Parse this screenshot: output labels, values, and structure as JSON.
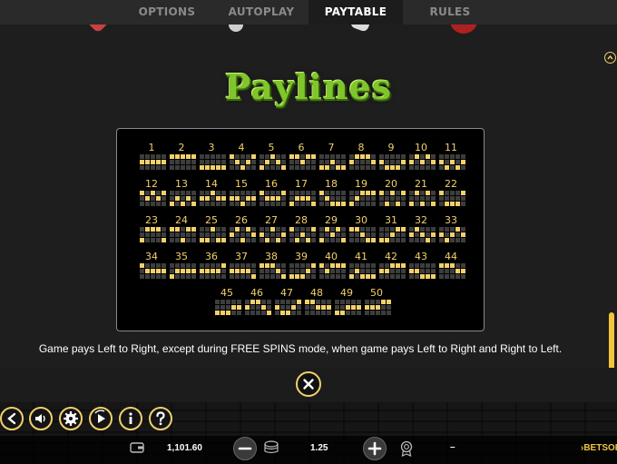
{
  "tabs": [
    {
      "label": "OPTIONS",
      "active": false
    },
    {
      "label": "AUTOPLAY",
      "active": false
    },
    {
      "label": "PAYTABLE",
      "active": true
    },
    {
      "label": "RULES",
      "active": false
    }
  ],
  "paytable": {
    "title": "Paylines",
    "description": "Game pays Left to Right, except during FREE SPINS mode, when game pays Left to Right and Right to Left."
  },
  "paylines": [
    {
      "n": "1",
      "rows": [
        1,
        1,
        1,
        1,
        1
      ]
    },
    {
      "n": "2",
      "rows": [
        0,
        0,
        0,
        0,
        0
      ]
    },
    {
      "n": "3",
      "rows": [
        2,
        2,
        2,
        2,
        2
      ]
    },
    {
      "n": "4",
      "rows": [
        0,
        1,
        2,
        1,
        0
      ]
    },
    {
      "n": "5",
      "rows": [
        2,
        1,
        0,
        1,
        2
      ]
    },
    {
      "n": "6",
      "rows": [
        0,
        0,
        1,
        0,
        0
      ]
    },
    {
      "n": "7",
      "rows": [
        2,
        2,
        1,
        2,
        2
      ]
    },
    {
      "n": "8",
      "rows": [
        1,
        0,
        0,
        0,
        1
      ]
    },
    {
      "n": "9",
      "rows": [
        1,
        2,
        2,
        2,
        1
      ]
    },
    {
      "n": "10",
      "rows": [
        1,
        0,
        1,
        0,
        1
      ]
    },
    {
      "n": "11",
      "rows": [
        1,
        2,
        1,
        2,
        1
      ]
    },
    {
      "n": "12",
      "rows": [
        0,
        1,
        0,
        1,
        0
      ]
    },
    {
      "n": "13",
      "rows": [
        2,
        1,
        2,
        1,
        2
      ]
    },
    {
      "n": "14",
      "rows": [
        1,
        1,
        0,
        1,
        1
      ]
    },
    {
      "n": "15",
      "rows": [
        1,
        1,
        2,
        1,
        1
      ]
    },
    {
      "n": "16",
      "rows": [
        0,
        1,
        1,
        1,
        0
      ]
    },
    {
      "n": "17",
      "rows": [
        2,
        1,
        1,
        1,
        2
      ]
    },
    {
      "n": "18",
      "rows": [
        0,
        1,
        2,
        2,
        2
      ]
    },
    {
      "n": "19",
      "rows": [
        2,
        1,
        0,
        0,
        0
      ]
    },
    {
      "n": "20",
      "rows": [
        0,
        2,
        0,
        2,
        0
      ]
    },
    {
      "n": "21",
      "rows": [
        2,
        0,
        2,
        0,
        2
      ]
    },
    {
      "n": "22",
      "rows": [
        0,
        2,
        2,
        2,
        0
      ]
    },
    {
      "n": "23",
      "rows": [
        2,
        0,
        0,
        0,
        2
      ]
    },
    {
      "n": "24",
      "rows": [
        0,
        0,
        2,
        0,
        0
      ]
    },
    {
      "n": "25",
      "rows": [
        2,
        2,
        0,
        2,
        2
      ]
    },
    {
      "n": "26",
      "rows": [
        1,
        0,
        2,
        0,
        1
      ]
    },
    {
      "n": "27",
      "rows": [
        1,
        2,
        0,
        2,
        1
      ]
    },
    {
      "n": "28",
      "rows": [
        0,
        2,
        1,
        2,
        0
      ]
    },
    {
      "n": "29",
      "rows": [
        2,
        0,
        1,
        0,
        2
      ]
    },
    {
      "n": "30",
      "rows": [
        0,
        0,
        1,
        2,
        2
      ]
    },
    {
      "n": "31",
      "rows": [
        2,
        2,
        1,
        0,
        0
      ]
    },
    {
      "n": "32",
      "rows": [
        1,
        0,
        1,
        2,
        1
      ]
    },
    {
      "n": "33",
      "rows": [
        1,
        2,
        1,
        0,
        1
      ]
    },
    {
      "n": "34",
      "rows": [
        0,
        1,
        1,
        1,
        1
      ]
    },
    {
      "n": "35",
      "rows": [
        2,
        1,
        1,
        1,
        1
      ]
    },
    {
      "n": "36",
      "rows": [
        1,
        1,
        1,
        1,
        0
      ]
    },
    {
      "n": "37",
      "rows": [
        1,
        1,
        1,
        1,
        2
      ]
    },
    {
      "n": "38",
      "rows": [
        0,
        0,
        0,
        1,
        2
      ]
    },
    {
      "n": "39",
      "rows": [
        2,
        2,
        2,
        1,
        0
      ]
    },
    {
      "n": "40",
      "rows": [
        0,
        1,
        0,
        0,
        0
      ]
    },
    {
      "n": "41",
      "rows": [
        2,
        1,
        2,
        2,
        2
      ]
    },
    {
      "n": "42",
      "rows": [
        1,
        1,
        0,
        0,
        0
      ]
    },
    {
      "n": "43",
      "rows": [
        1,
        1,
        2,
        2,
        2
      ]
    },
    {
      "n": "44",
      "rows": [
        0,
        0,
        0,
        1,
        1
      ]
    },
    {
      "n": "45",
      "rows": [
        2,
        2,
        2,
        1,
        1
      ]
    },
    {
      "n": "46",
      "rows": [
        1,
        0,
        0,
        1,
        2
      ]
    },
    {
      "n": "47",
      "rows": [
        1,
        2,
        2,
        1,
        0
      ]
    },
    {
      "n": "48",
      "rows": [
        0,
        0,
        1,
        1,
        1
      ]
    },
    {
      "n": "49",
      "rows": [
        2,
        2,
        1,
        1,
        1
      ]
    },
    {
      "n": "50",
      "rows": [
        1,
        1,
        1,
        0,
        0
      ]
    }
  ],
  "status": {
    "balance": "1,101.60",
    "bet": "1.25",
    "win": "–",
    "brand": "›BETSOFT"
  },
  "controls": [
    {
      "name": "back-icon"
    },
    {
      "name": "sound-icon"
    },
    {
      "name": "settings-gear-icon"
    },
    {
      "name": "autoplay-icon"
    },
    {
      "name": "info-icon"
    },
    {
      "name": "help-icon"
    }
  ],
  "colors": {
    "accent": "#f2c53d",
    "title_green": "#7fc62a",
    "panel_bg": "#1e1e1e",
    "grid_bg": "#000000"
  }
}
